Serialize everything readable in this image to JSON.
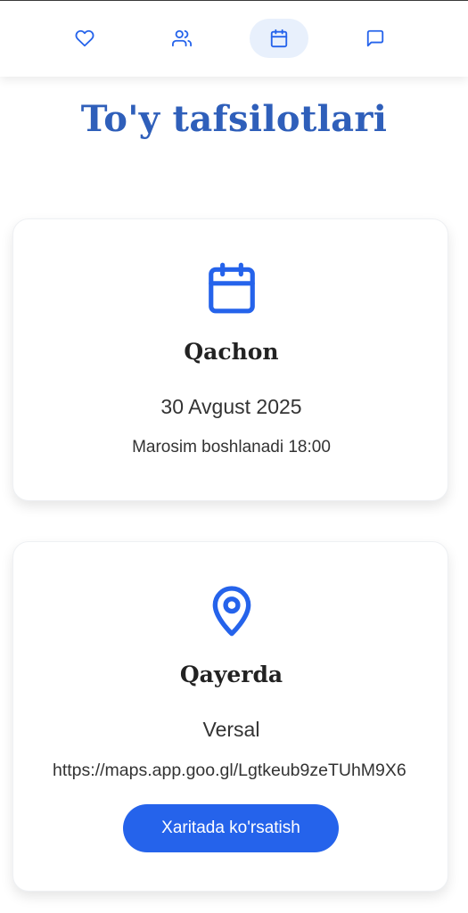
{
  "nav": {
    "items": [
      {
        "name": "heart-icon"
      },
      {
        "name": "users-icon"
      },
      {
        "name": "calendar-icon",
        "active": true
      },
      {
        "name": "message-icon"
      }
    ]
  },
  "page": {
    "title": "To'y tafsilotlari"
  },
  "when_card": {
    "icon": "calendar-icon",
    "heading": "Qachon",
    "date": "30 Avgust 2025",
    "time_note": "Marosim boshlanadi 18:00"
  },
  "where_card": {
    "icon": "map-pin-icon",
    "heading": "Qayerda",
    "venue": "Versal",
    "map_url": "https://maps.app.goo.gl/Lgtkeub9zeTUhM9X6",
    "button_label": "Xaritada ko'rsatish"
  },
  "colors": {
    "accent": "#2563eb",
    "title": "#2f5fba",
    "active_nav_bg": "#e8f0fc"
  }
}
